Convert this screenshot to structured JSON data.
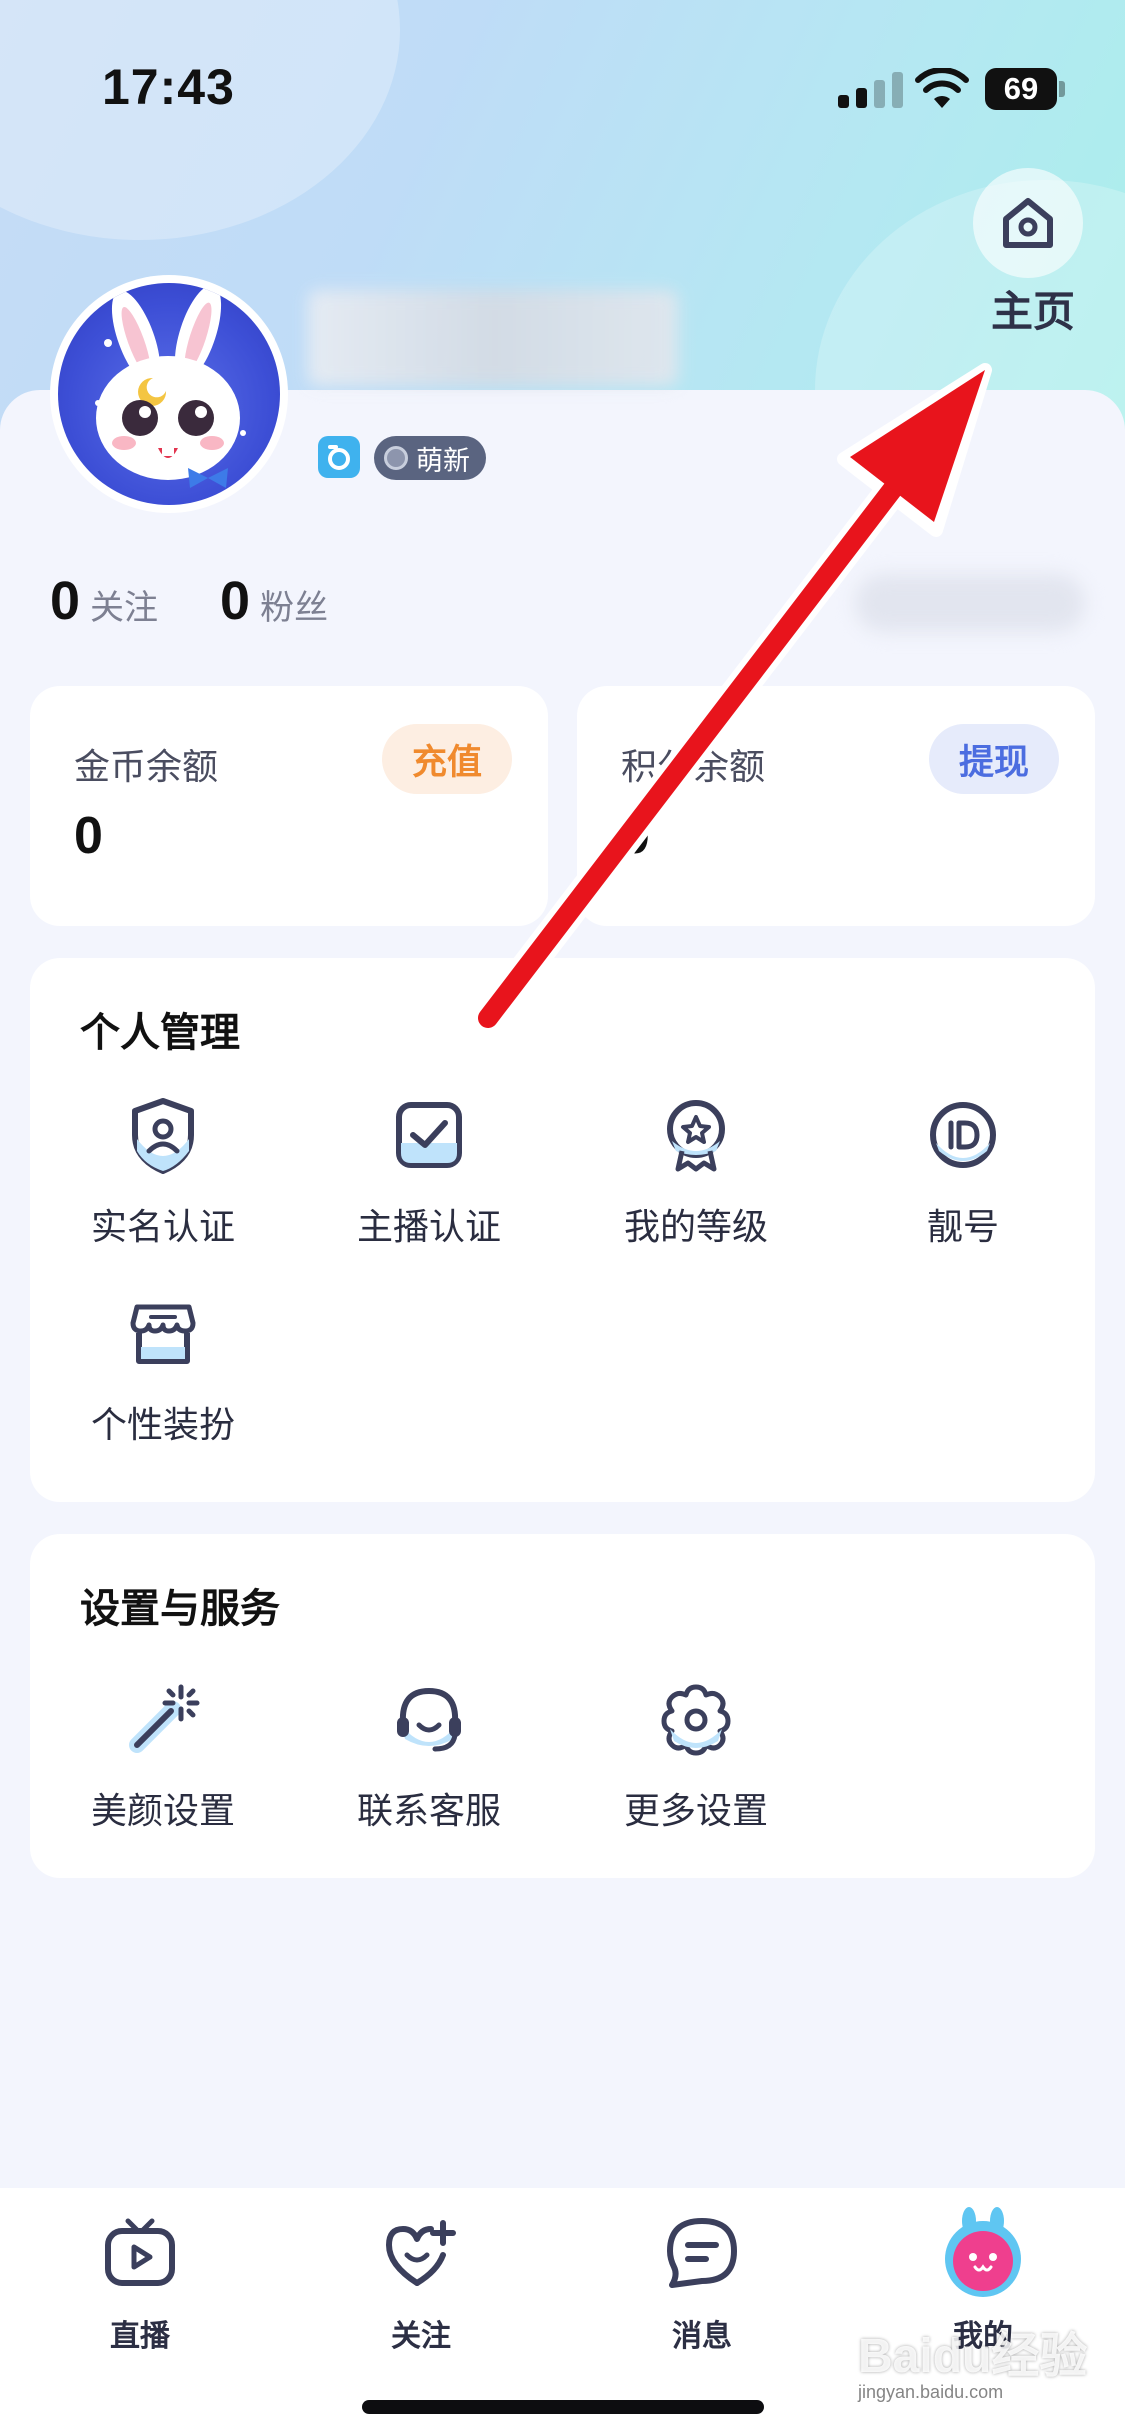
{
  "status_bar": {
    "time": "17:43",
    "battery": "69"
  },
  "header": {
    "home_label": "主页"
  },
  "profile": {
    "tag_level": "萌新",
    "following_count": "0",
    "following_label": "关注",
    "fans_count": "0",
    "fans_label": "粉丝"
  },
  "wallet": {
    "coins": {
      "title": "金币余额",
      "amount": "0",
      "action": "充值"
    },
    "points": {
      "title": "积分余额",
      "amount": "0",
      "action": "提现"
    }
  },
  "personal": {
    "title": "个人管理",
    "items": [
      {
        "label": "实名认证",
        "icon": "shield-user-icon"
      },
      {
        "label": "主播认证",
        "icon": "check-square-icon"
      },
      {
        "label": "我的等级",
        "icon": "medal-star-icon"
      },
      {
        "label": "靓号",
        "icon": "id-circle-icon"
      },
      {
        "label": "个性装扮",
        "icon": "shop-icon"
      }
    ]
  },
  "services": {
    "title": "设置与服务",
    "items": [
      {
        "label": "美颜设置",
        "icon": "magic-wand-icon"
      },
      {
        "label": "联系客服",
        "icon": "headset-icon"
      },
      {
        "label": "更多设置",
        "icon": "gear-icon"
      }
    ]
  },
  "tabbar": {
    "items": [
      {
        "label": "直播",
        "icon": "tv-play-icon"
      },
      {
        "label": "关注",
        "icon": "heart-plus-icon"
      },
      {
        "label": "消息",
        "icon": "message-icon"
      },
      {
        "label": "我的",
        "icon": "bunny-avatar-icon"
      }
    ]
  },
  "watermark": {
    "brand": "Baidu经验",
    "url": "jingyan.baidu.com"
  },
  "colors": {
    "accent": "#4c6de0",
    "recharge": "#f08a2e",
    "arrow": "#e8141c",
    "icon_stroke": "#3b3f5c",
    "icon_fill": "#bfe3fb"
  }
}
